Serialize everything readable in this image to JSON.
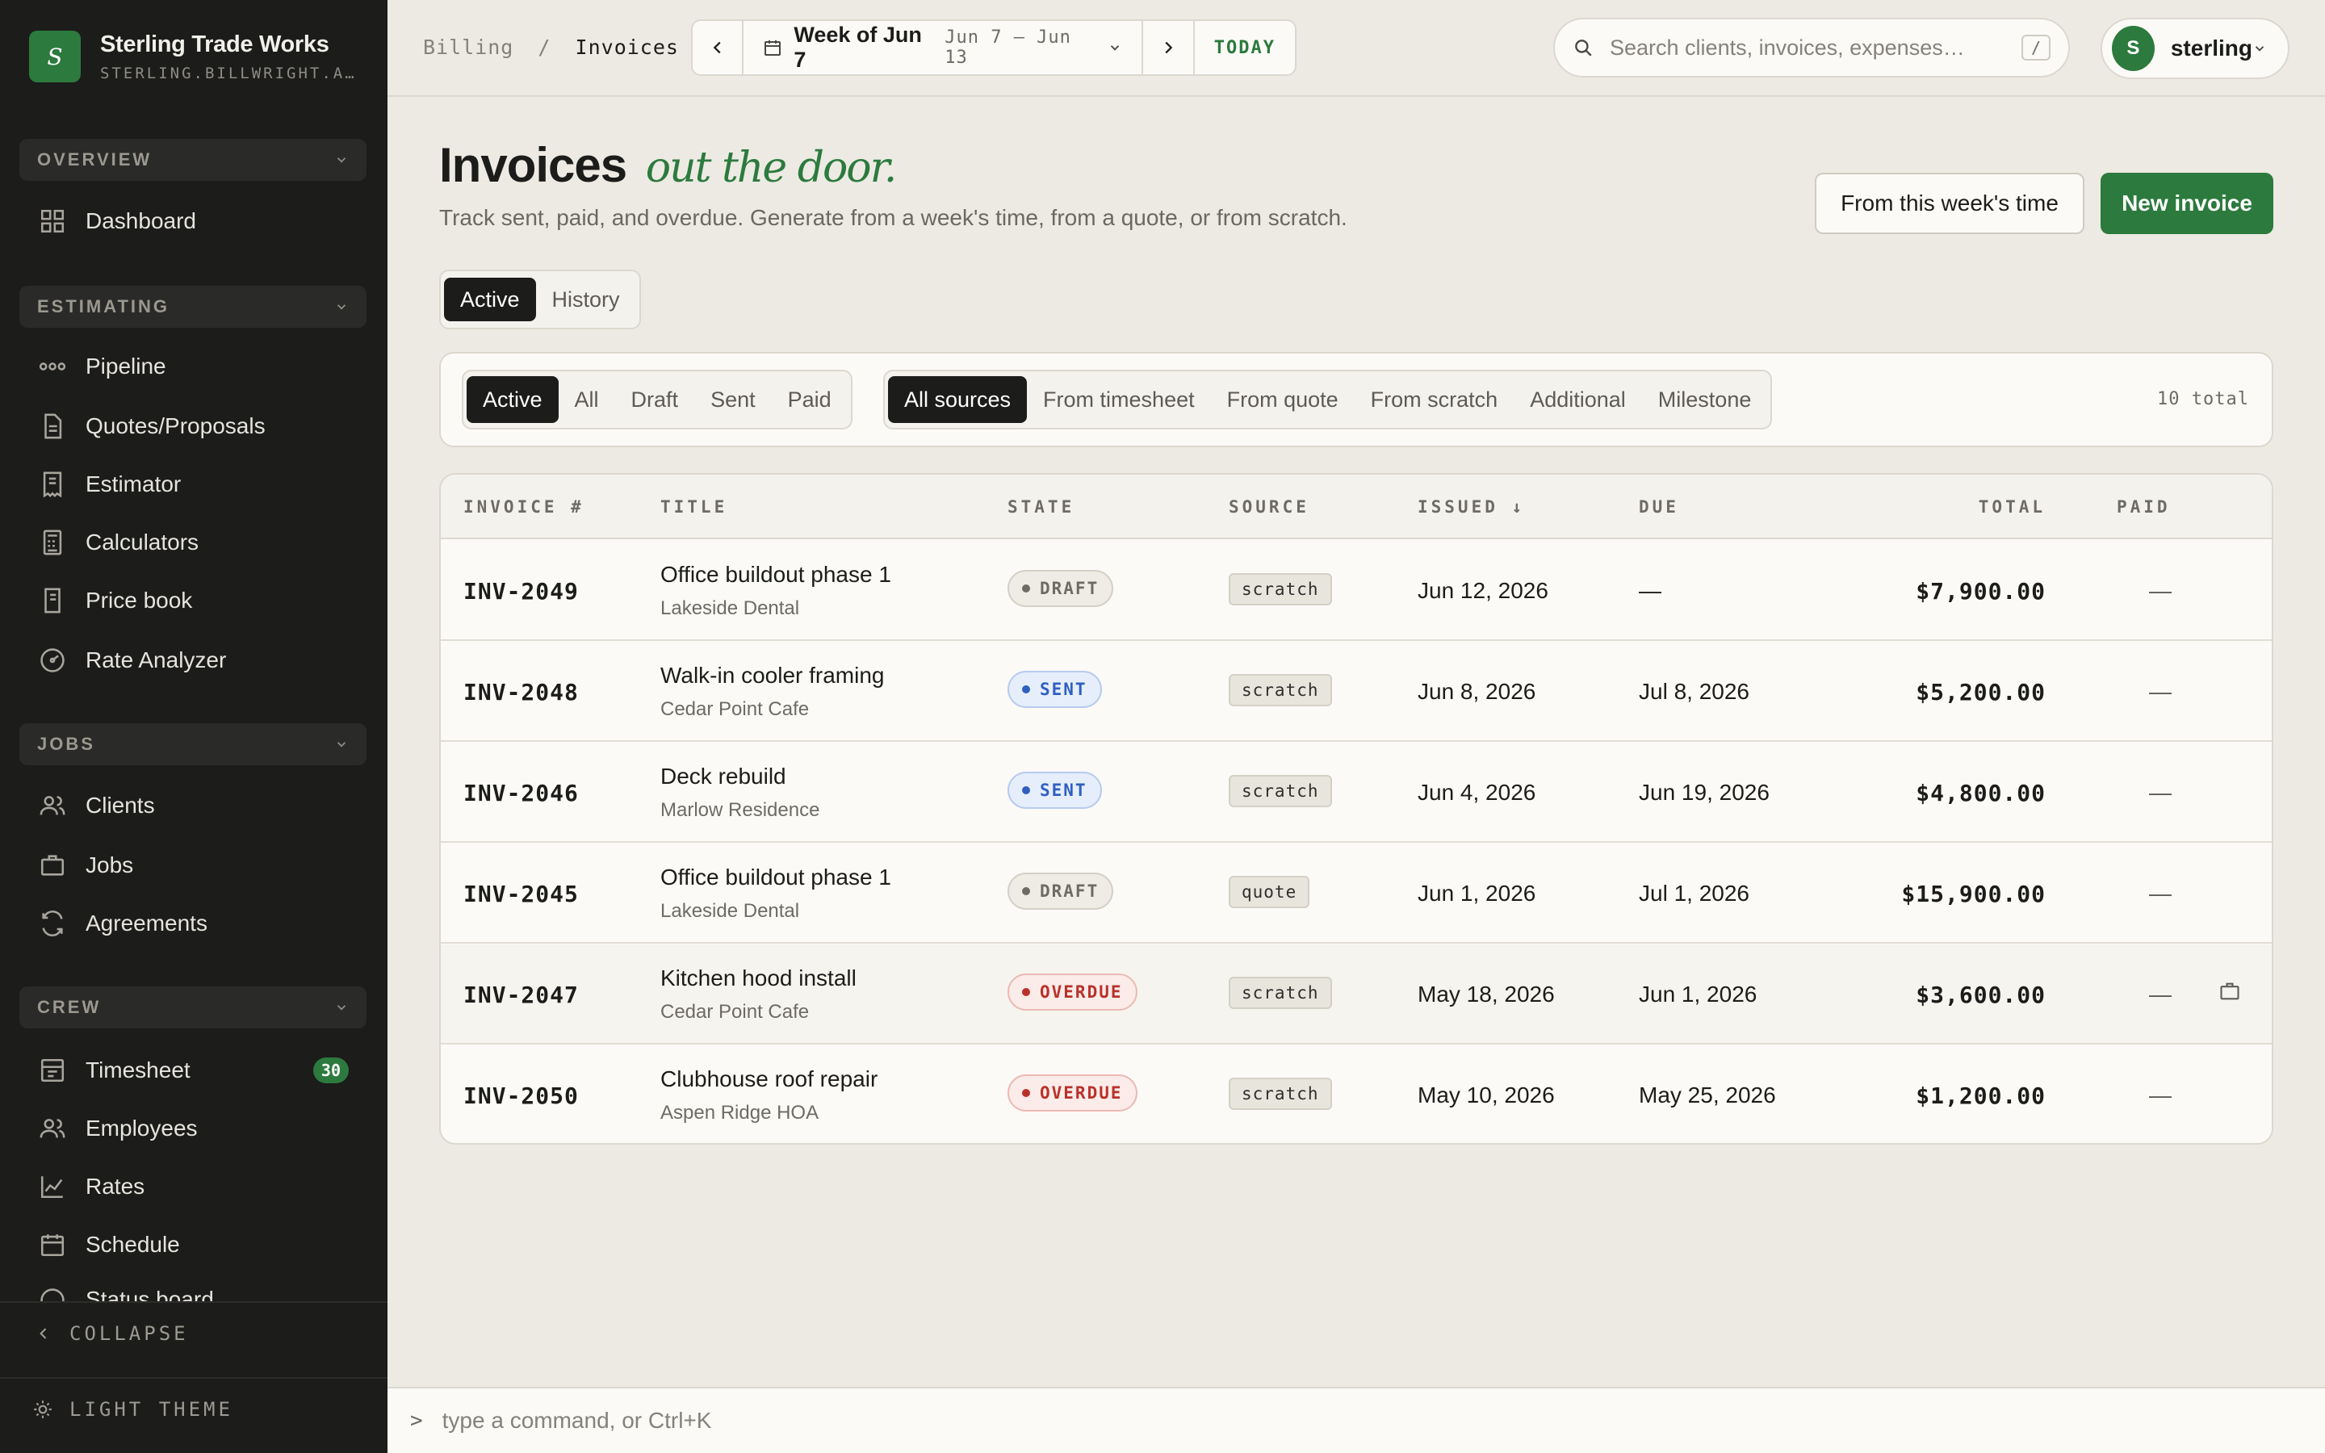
{
  "brand": {
    "name": "Sterling Trade Works",
    "domain": "STERLING.BILLWRIGHT.A…",
    "logo_letter": "S"
  },
  "sidebar": {
    "sections": [
      {
        "label": "OVERVIEW",
        "items": [
          {
            "label": "Dashboard",
            "icon": "grid-icon"
          }
        ]
      },
      {
        "label": "ESTIMATING",
        "items": [
          {
            "label": "Pipeline",
            "icon": "pipeline-icon"
          },
          {
            "label": "Quotes/Proposals",
            "icon": "document-icon"
          },
          {
            "label": "Estimator",
            "icon": "receipt-icon"
          },
          {
            "label": "Calculators",
            "icon": "calculator-icon"
          },
          {
            "label": "Price book",
            "icon": "book-icon"
          },
          {
            "label": "Rate Analyzer",
            "icon": "gauge-icon"
          }
        ]
      },
      {
        "label": "JOBS",
        "items": [
          {
            "label": "Clients",
            "icon": "users-icon"
          },
          {
            "label": "Jobs",
            "icon": "briefcase-icon"
          },
          {
            "label": "Agreements",
            "icon": "refresh-icon"
          }
        ]
      },
      {
        "label": "CREW",
        "items": [
          {
            "label": "Timesheet",
            "icon": "timesheet-icon",
            "badge": "30"
          },
          {
            "label": "Employees",
            "icon": "users-icon"
          },
          {
            "label": "Rates",
            "icon": "chart-line-icon"
          },
          {
            "label": "Schedule",
            "icon": "calendar-icon"
          },
          {
            "label": "Status board",
            "icon": "status-icon"
          }
        ]
      }
    ],
    "collapse_label": "COLLAPSE",
    "theme_label": "LIGHT THEME"
  },
  "topbar": {
    "breadcrumb": [
      "Billing",
      "Invoices"
    ],
    "breadcrumb_sep": "/",
    "week_title": "Week of Jun 7",
    "week_range": "Jun 7 – Jun 13",
    "today_label": "TODAY",
    "search_placeholder": "Search clients, invoices, expenses…",
    "search_shortcut": "/",
    "user": {
      "initial": "S",
      "name": "sterling"
    }
  },
  "page": {
    "title": "Invoices",
    "title_accent": "out the door.",
    "subtitle": "Track sent, paid, and overdue. Generate from a week's time, from a quote, or from scratch.",
    "btn_from_week": "From this week's time",
    "btn_new": "New invoice",
    "view_tabs": [
      "Active",
      "History"
    ],
    "active_view": "Active",
    "status_filters": [
      "Active",
      "All",
      "Draft",
      "Sent",
      "Paid"
    ],
    "active_status": "Active",
    "source_filters": [
      "All sources",
      "From timesheet",
      "From quote",
      "From scratch",
      "Additional",
      "Milestone"
    ],
    "active_source": "All sources",
    "total_label": "10 total"
  },
  "table": {
    "headers": {
      "invoice": "INVOICE #",
      "title": "TITLE",
      "state": "STATE",
      "source": "SOURCE",
      "issued": "ISSUED ↓",
      "due": "DUE",
      "total": "TOTAL",
      "paid": "PAID"
    },
    "rows": [
      {
        "id": "INV-2049",
        "title": "Office buildout phase 1",
        "client": "Lakeside Dental",
        "state": "DRAFT",
        "source": "scratch",
        "issued": "Jun 12, 2026",
        "due": "—",
        "total": "$7,900.00",
        "paid": "—"
      },
      {
        "id": "INV-2048",
        "title": "Walk-in cooler framing",
        "client": "Cedar Point Cafe",
        "state": "SENT",
        "source": "scratch",
        "issued": "Jun 8, 2026",
        "due": "Jul 8, 2026",
        "total": "$5,200.00",
        "paid": "—"
      },
      {
        "id": "INV-2046",
        "title": "Deck rebuild",
        "client": "Marlow Residence",
        "state": "SENT",
        "source": "scratch",
        "issued": "Jun 4, 2026",
        "due": "Jun 19, 2026",
        "total": "$4,800.00",
        "paid": "—"
      },
      {
        "id": "INV-2045",
        "title": "Office buildout phase 1",
        "client": "Lakeside Dental",
        "state": "DRAFT",
        "source": "quote",
        "issued": "Jun 1, 2026",
        "due": "Jul 1, 2026",
        "total": "$15,900.00",
        "paid": "—"
      },
      {
        "id": "INV-2047",
        "title": "Kitchen hood install",
        "client": "Cedar Point Cafe",
        "state": "OVERDUE",
        "source": "scratch",
        "issued": "May 18, 2026",
        "due": "Jun 1, 2026",
        "total": "$3,600.00",
        "paid": "—"
      },
      {
        "id": "INV-2050",
        "title": "Clubhouse roof repair",
        "client": "Aspen Ridge HOA",
        "state": "OVERDUE",
        "source": "scratch",
        "issued": "May 10, 2026",
        "due": "May 25, 2026",
        "total": "$1,200.00",
        "paid": "—"
      }
    ]
  },
  "command_bar": {
    "prompt": ">",
    "placeholder": "type a command, or Ctrl+K"
  },
  "colors": {
    "accent": "#2c7a3e",
    "sidebar_bg": "#1c1c1b",
    "page_bg": "#edeae3",
    "draft": "#6e6b64",
    "sent": "#2f5fbf",
    "overdue": "#b8322a"
  }
}
